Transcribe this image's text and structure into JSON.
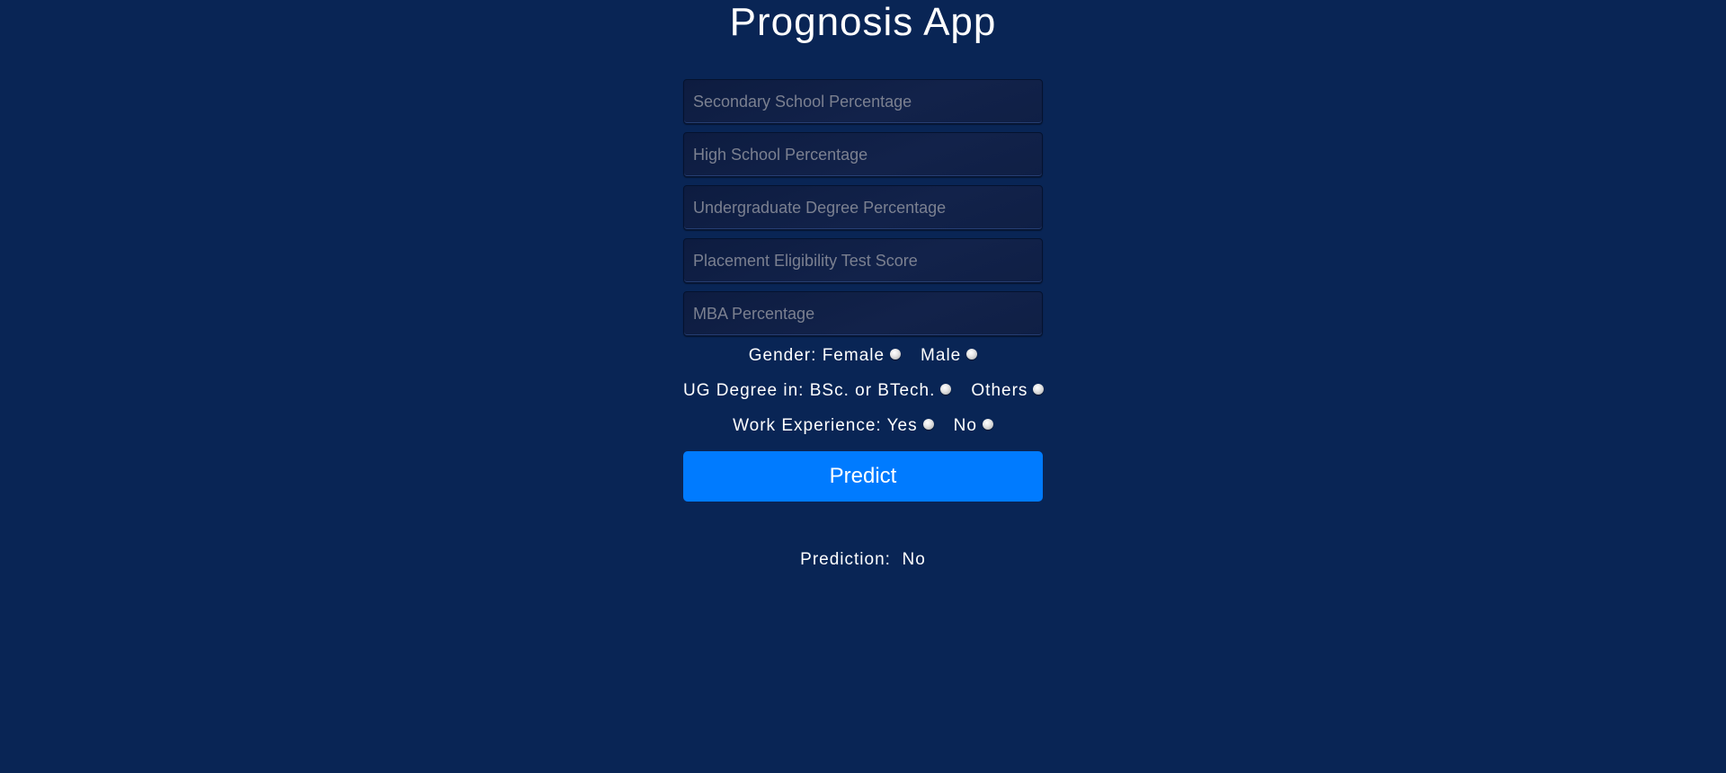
{
  "app": {
    "title": "Prognosis App"
  },
  "form": {
    "fields": [
      {
        "placeholder": "Secondary School Percentage",
        "value": ""
      },
      {
        "placeholder": "High School Percentage",
        "value": ""
      },
      {
        "placeholder": "Undergraduate Degree Percentage",
        "value": ""
      },
      {
        "placeholder": "Placement Eligibility Test Score",
        "value": ""
      },
      {
        "placeholder": "MBA Percentage",
        "value": ""
      }
    ],
    "gender": {
      "label": "Gender:",
      "options": [
        "Female",
        "Male"
      ]
    },
    "ug_degree": {
      "label": "UG Degree in:",
      "options": [
        "BSc. or BTech.",
        "Others"
      ]
    },
    "work_experience": {
      "label": "Work Experience:",
      "options": [
        "Yes",
        "No"
      ]
    },
    "predict_label": "Predict"
  },
  "result": {
    "label": "Prediction:",
    "value": "No"
  },
  "colors": {
    "background": "#092555",
    "button": "#007bff",
    "text": "#ffffff",
    "placeholder": "#7b8090"
  }
}
